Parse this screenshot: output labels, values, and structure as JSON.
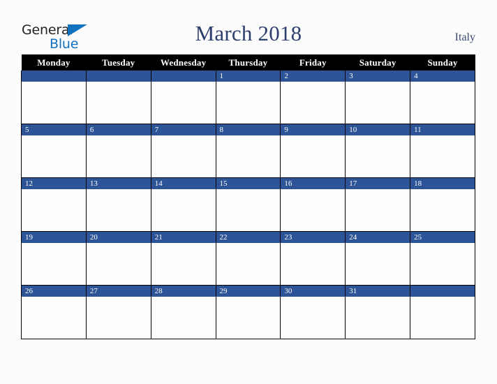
{
  "brand": {
    "logo_text_primary": "General",
    "logo_text_secondary": "Blue",
    "logo_triangle_icon": "triangle-icon",
    "primary_color": "#1272c0",
    "text_color": "#231f20"
  },
  "header": {
    "title": "March 2018",
    "country": "Italy",
    "title_color": "#2c3e6b"
  },
  "calendar": {
    "month": "March",
    "year": "2018",
    "header_background": "#000000",
    "daynum_background": "#2d5496",
    "cell_background": "#fdfdfd",
    "border_color": "#000000",
    "weekday_headers": [
      "Monday",
      "Tuesday",
      "Wednesday",
      "Thursday",
      "Friday",
      "Saturday",
      "Sunday"
    ],
    "weeks": [
      [
        "",
        "",
        "",
        "1",
        "2",
        "3",
        "4"
      ],
      [
        "5",
        "6",
        "7",
        "8",
        "9",
        "10",
        "11"
      ],
      [
        "12",
        "13",
        "14",
        "15",
        "16",
        "17",
        "18"
      ],
      [
        "19",
        "20",
        "21",
        "22",
        "23",
        "24",
        "25"
      ],
      [
        "26",
        "27",
        "28",
        "29",
        "30",
        "31",
        ""
      ]
    ]
  }
}
